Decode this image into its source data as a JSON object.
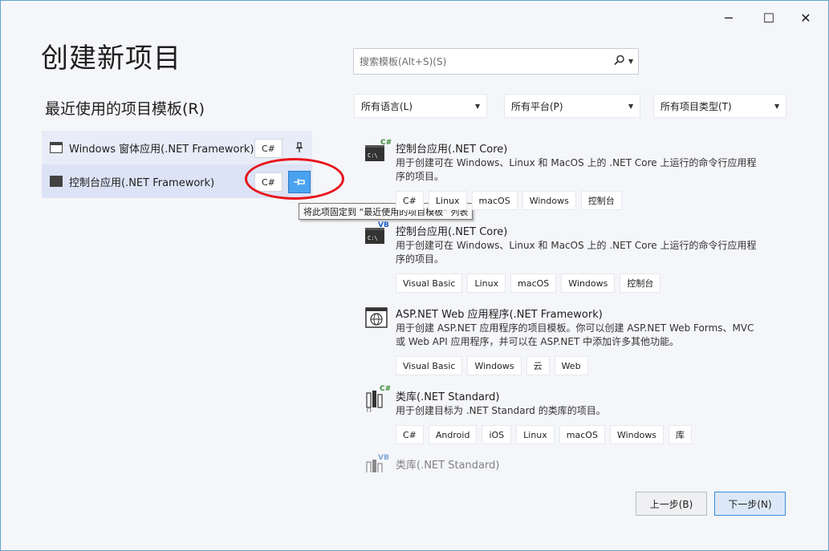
{
  "window": {
    "minimize": "─",
    "maximize": "☐",
    "close": "✕"
  },
  "page_title": "创建新项目",
  "recent": {
    "title": "最近使用的项目模板(R)",
    "items": [
      {
        "label": "Windows 窗体应用(.NET Framework)",
        "lang": "C#",
        "icon": "winforms-icon"
      },
      {
        "label": "控制台应用(.NET Framework)",
        "lang": "C#",
        "icon": "console-icon"
      }
    ],
    "tooltip": "将此项固定到 “最近使用的项目模板” 列表"
  },
  "search": {
    "placeholder": "搜索模板(Alt+S)(S)",
    "icon": "search-icon"
  },
  "filters": {
    "language": "所有语言(L)",
    "platform": "所有平台(P)",
    "project_type": "所有项目类型(T)"
  },
  "templates": [
    {
      "name": "控制台应用(.NET Core)",
      "badge": "C#",
      "desc": "用于创建可在 Windows、Linux 和 MacOS 上的 .NET Core 上运行的命令行应用程序的项目。",
      "tags": [
        "C#",
        "Linux",
        "macOS",
        "Windows",
        "控制台"
      ]
    },
    {
      "name": "控制台应用(.NET Core)",
      "badge": "VB",
      "desc": "用于创建可在 Windows、Linux 和 MacOS 上的 .NET Core 上运行的命令行应用程序的项目。",
      "tags": [
        "Visual Basic",
        "Linux",
        "macOS",
        "Windows",
        "控制台"
      ]
    },
    {
      "name": "ASP.NET Web 应用程序(.NET Framework)",
      "badge": "",
      "desc": "用于创建 ASP.NET 应用程序的项目模板。你可以创建 ASP.NET Web Forms、MVC 或 Web API 应用程序，并可以在 ASP.NET 中添加许多其他功能。",
      "tags": [
        "Visual Basic",
        "Windows",
        "云",
        "Web"
      ]
    },
    {
      "name": "类库(.NET Standard)",
      "badge": "C#",
      "desc": "用于创建目标为 .NET Standard 的类库的项目。",
      "tags": [
        "C#",
        "Android",
        "iOS",
        "Linux",
        "macOS",
        "Windows",
        "库"
      ]
    },
    {
      "name": "类库(.NET Standard)",
      "badge": "VB",
      "desc": "",
      "tags": []
    }
  ],
  "buttons": {
    "back": "上一步(B)",
    "next": "下一步(N)"
  },
  "colors": {
    "accent": "#3b8ddb",
    "pin_hover": "#4aa3f0",
    "annotation": "#e8141b",
    "csharp_badge": "#388a34",
    "vb_badge": "#1f5fbf"
  }
}
